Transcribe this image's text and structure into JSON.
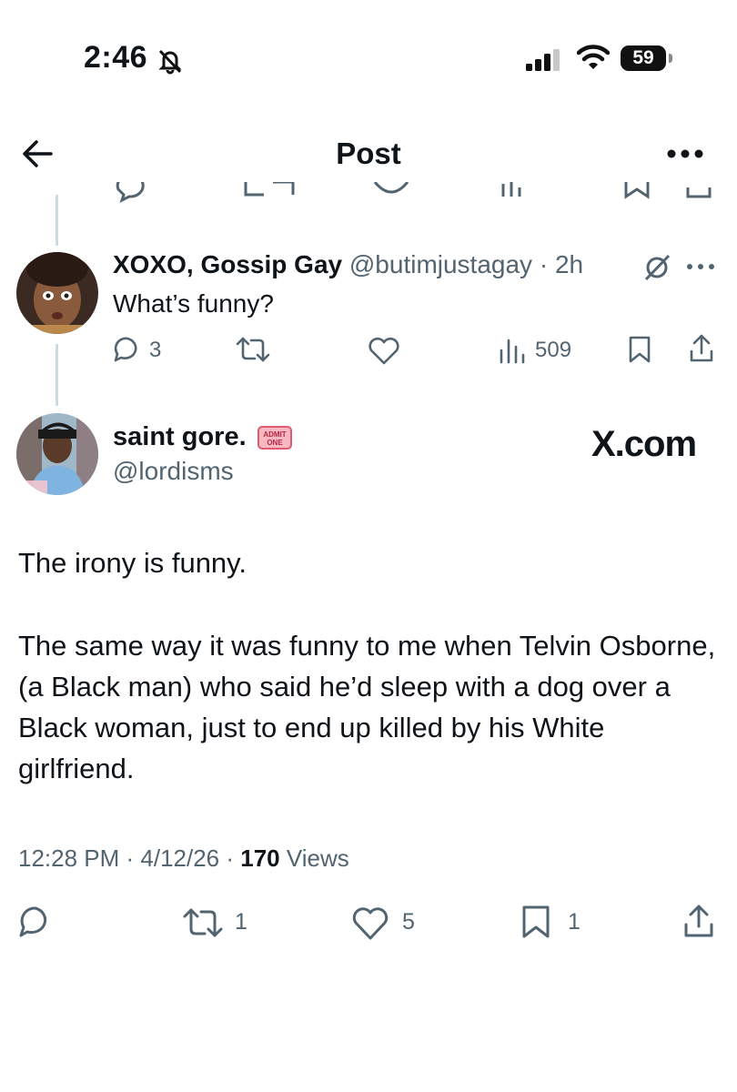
{
  "status_bar": {
    "time": "2:46",
    "battery": "59"
  },
  "header": {
    "title": "Post"
  },
  "reply": {
    "display_name": "XOXO, Gossip Gay",
    "handle_time": "@butimjustagay · 2h",
    "text": "What’s funny?",
    "replies": "3",
    "views": "509"
  },
  "main_post": {
    "display_name": "saint gore.",
    "badge_text": "ADMIT ONE",
    "handle": "@lordisms",
    "watermark": "X.com",
    "paragraph_1": "The irony is funny.",
    "paragraph_2": "The same way it was funny to me when Telvin Osborne, (a Black man) who said he’d sleep with a dog over a Black woman, just to end up killed by his White girlfriend.",
    "time_date": "12:28 PM · 4/12/26 · ",
    "views_count": "170",
    "views_label": " Views",
    "reposts": "1",
    "likes": "5",
    "bookmarks": "1"
  },
  "colors": {
    "text": "#0f1419",
    "secondary": "#536471",
    "thread_line": "#cfd9de"
  },
  "icons": [
    "bell-slash-icon",
    "signal-icon",
    "wifi-icon",
    "back-arrow-icon",
    "more-icon",
    "reply-icon",
    "repost-icon",
    "like-icon",
    "views-icon",
    "bookmark-icon",
    "share-icon",
    "grok-icon"
  ]
}
